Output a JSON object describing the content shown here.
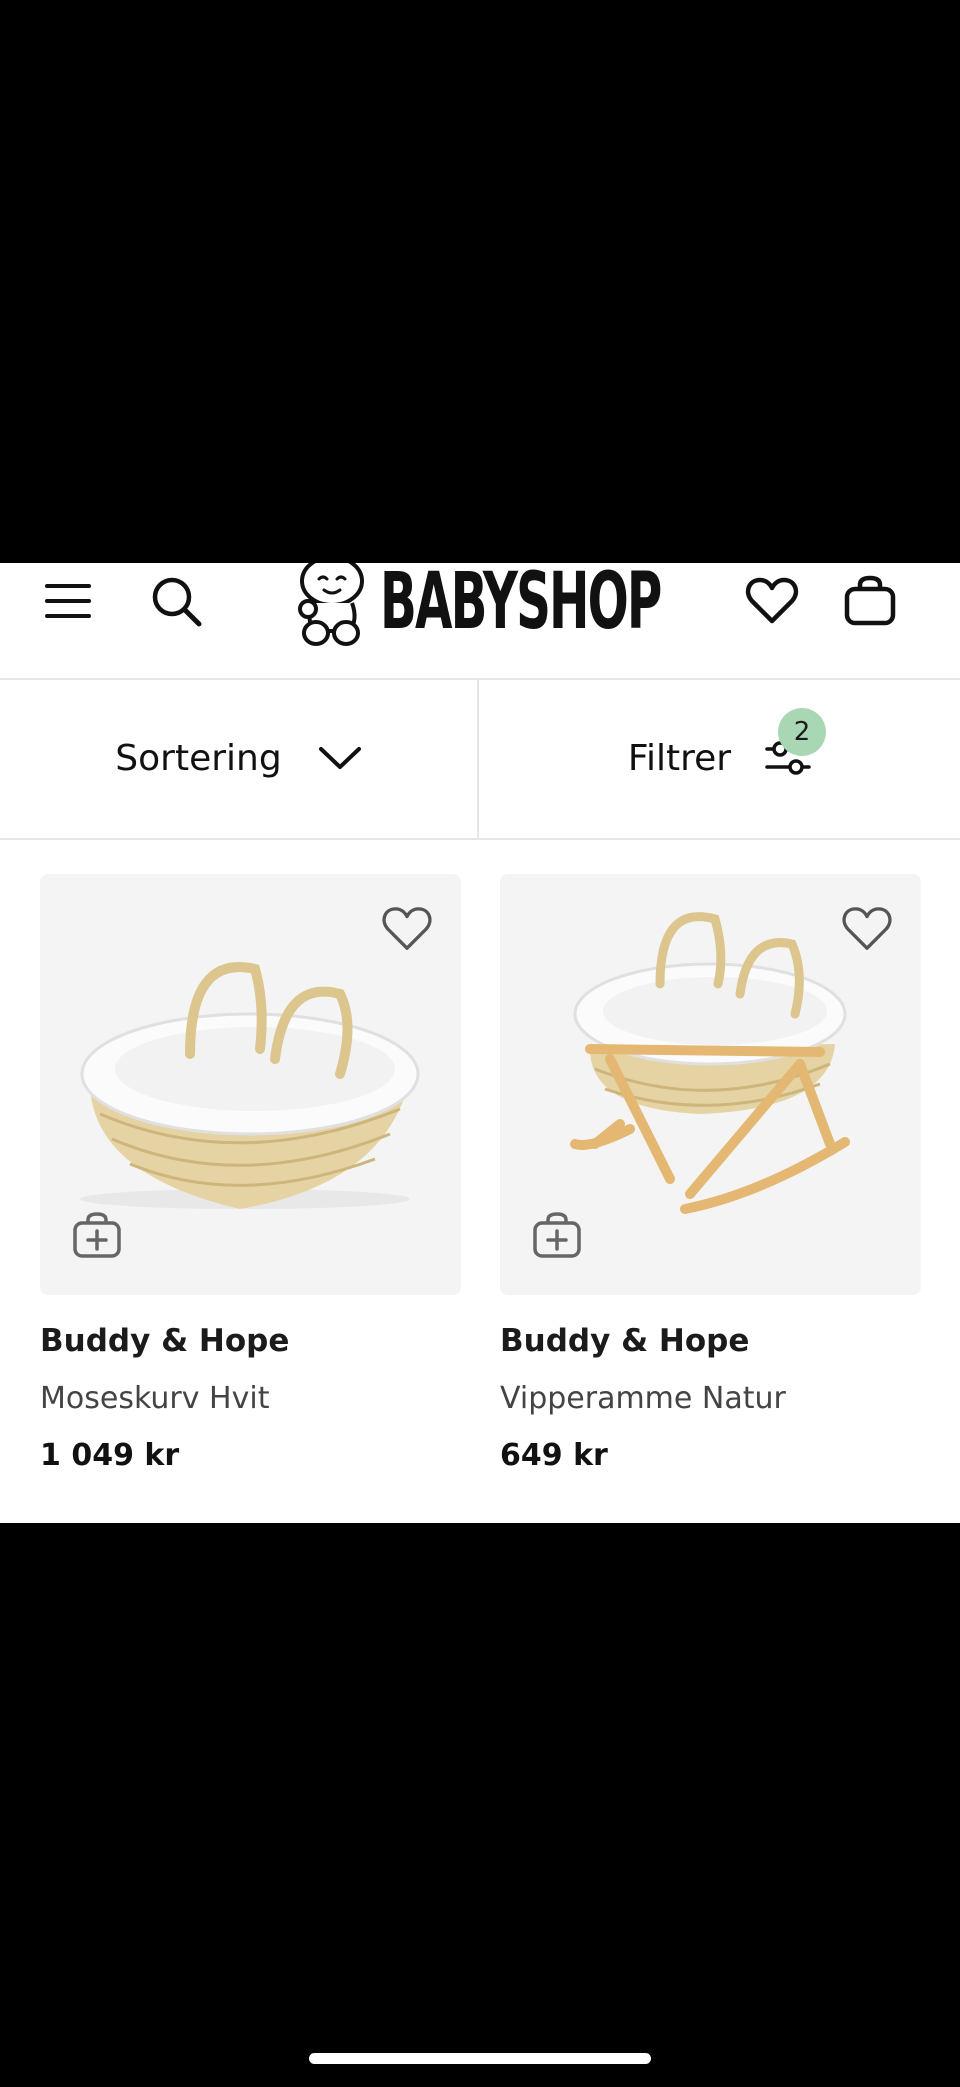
{
  "header": {
    "logo_text": "BABYSHOP",
    "icons": [
      "menu-icon",
      "search-icon",
      "heart-icon",
      "bag-icon"
    ]
  },
  "toolbar": {
    "sort_label": "Sortering",
    "filter_label": "Filtrer",
    "filter_count": "2"
  },
  "products": [
    {
      "brand": "Buddy & Hope",
      "name": "Moseskurv Hvit",
      "price": "1 049 kr"
    },
    {
      "brand": "Buddy & Hope",
      "name": "Vipperamme Natur",
      "price": "649 kr"
    }
  ],
  "colors": {
    "badge": "#a9d7b4",
    "card_bg": "#f4f4f4"
  }
}
